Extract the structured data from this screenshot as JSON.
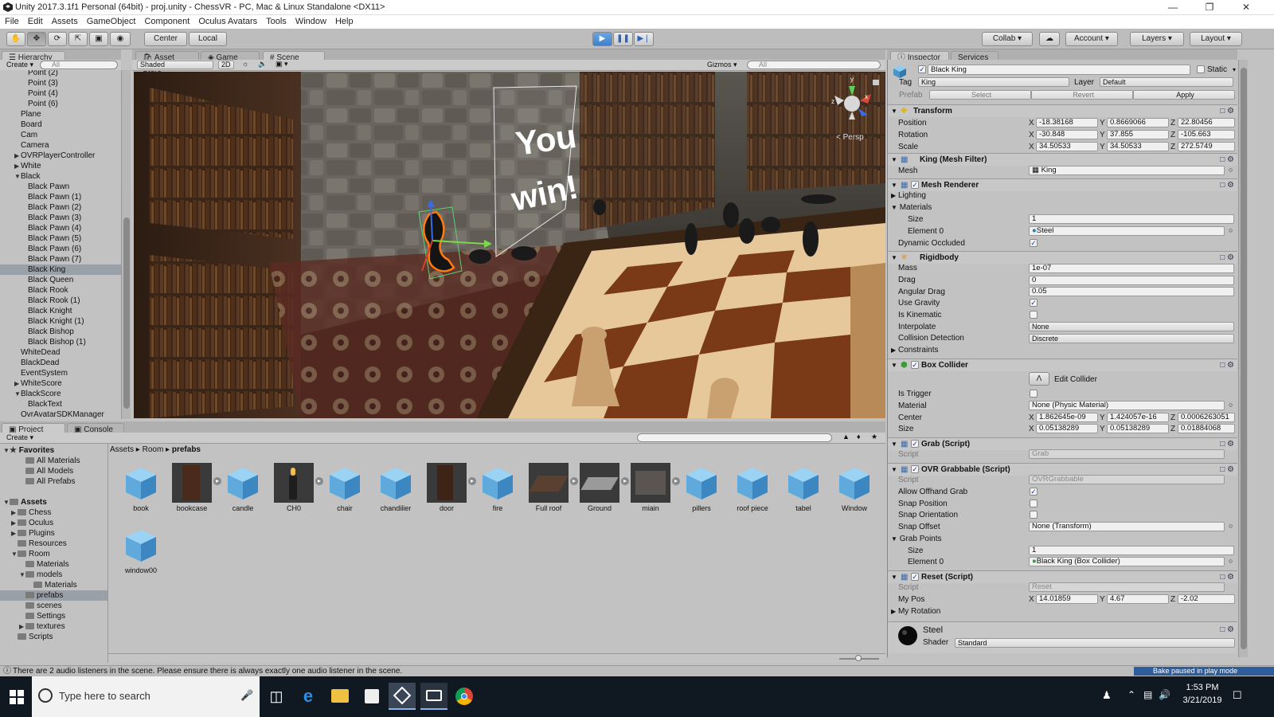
{
  "window": {
    "title": "Unity 2017.3.1f1 Personal (64bit) - proj.unity - ChessVR - PC, Mac & Linux Standalone <DX11>"
  },
  "menu": [
    "File",
    "Edit",
    "Assets",
    "GameObject",
    "Component",
    "Oculus Avatars",
    "Tools",
    "Window",
    "Help"
  ],
  "toolbar": {
    "center": "Center",
    "local": "Local",
    "collab": "Collab",
    "account": "Account",
    "layers": "Layers",
    "layout": "Layout"
  },
  "hierarchy": {
    "tab": "Hierarchy",
    "create": "Create",
    "search": "All",
    "rows": [
      {
        "label": "Point (2)",
        "indent": 3,
        "arrow": ""
      },
      {
        "label": "Point (3)",
        "indent": 3,
        "arrow": ""
      },
      {
        "label": "Point (4)",
        "indent": 3,
        "arrow": ""
      },
      {
        "label": "Point (6)",
        "indent": 3,
        "arrow": ""
      },
      {
        "label": "Plane",
        "indent": 2,
        "arrow": ""
      },
      {
        "label": "Board",
        "indent": 2,
        "arrow": ""
      },
      {
        "label": "Cam",
        "indent": 2,
        "arrow": ""
      },
      {
        "label": "Camera",
        "indent": 2,
        "arrow": ""
      },
      {
        "label": "OVRPlayerController",
        "indent": 2,
        "arrow": "▶"
      },
      {
        "label": "White",
        "indent": 2,
        "arrow": "▶"
      },
      {
        "label": "Black",
        "indent": 2,
        "arrow": "▼"
      },
      {
        "label": "Black Pawn",
        "indent": 3,
        "arrow": ""
      },
      {
        "label": "Black Pawn (1)",
        "indent": 3,
        "arrow": ""
      },
      {
        "label": "Black Pawn (2)",
        "indent": 3,
        "arrow": ""
      },
      {
        "label": "Black Pawn (3)",
        "indent": 3,
        "arrow": ""
      },
      {
        "label": "Black Pawn (4)",
        "indent": 3,
        "arrow": ""
      },
      {
        "label": "Black Pawn (5)",
        "indent": 3,
        "arrow": ""
      },
      {
        "label": "Black Pawn (6)",
        "indent": 3,
        "arrow": ""
      },
      {
        "label": "Black Pawn (7)",
        "indent": 3,
        "arrow": ""
      },
      {
        "label": "Black King",
        "indent": 3,
        "arrow": "",
        "selected": true
      },
      {
        "label": "Black Queen",
        "indent": 3,
        "arrow": ""
      },
      {
        "label": "Black Rook",
        "indent": 3,
        "arrow": ""
      },
      {
        "label": "Black Rook (1)",
        "indent": 3,
        "arrow": ""
      },
      {
        "label": "Black Knight",
        "indent": 3,
        "arrow": ""
      },
      {
        "label": "Black Knight (1)",
        "indent": 3,
        "arrow": ""
      },
      {
        "label": "Black Bishop",
        "indent": 3,
        "arrow": ""
      },
      {
        "label": "Black Bishop (1)",
        "indent": 3,
        "arrow": ""
      },
      {
        "label": "WhiteDead",
        "indent": 2,
        "arrow": ""
      },
      {
        "label": "BlackDead",
        "indent": 2,
        "arrow": ""
      },
      {
        "label": "EventSystem",
        "indent": 2,
        "arrow": ""
      },
      {
        "label": "WhiteScore",
        "indent": 2,
        "arrow": "▶"
      },
      {
        "label": "BlackScore",
        "indent": 2,
        "arrow": "▼"
      },
      {
        "label": "BlackText",
        "indent": 3,
        "arrow": ""
      },
      {
        "label": "OvrAvatarSDKManager",
        "indent": 2,
        "arrow": ""
      }
    ]
  },
  "sceneTabs": {
    "assetStore": "Asset Store",
    "game": "Game",
    "scene": "Scene"
  },
  "sceneBar": {
    "shaded": "Shaded",
    "twoD": "2D",
    "gizmos": "Gizmos",
    "search": "All"
  },
  "scene": {
    "win1": "You",
    "win2": "win!",
    "persp": "< Persp"
  },
  "inspector": {
    "tab": "Inspector",
    "services": "Services",
    "name": "Black King",
    "static": "Static",
    "tagLabel": "Tag",
    "tag": "King",
    "layerLabel": "Layer",
    "layer": "Default",
    "prefabLabel": "Prefab",
    "select": "Select",
    "revert": "Revert",
    "apply": "Apply",
    "transform": {
      "title": "Transform",
      "rows": [
        {
          "label": "Position",
          "x": "-18.38168",
          "y": "0.8669066",
          "z": "22.80456"
        },
        {
          "label": "Rotation",
          "x": "-30.848",
          "y": "37.855",
          "z": "-105.663"
        },
        {
          "label": "Scale",
          "x": "34.50533",
          "y": "34.50533",
          "z": "272.5749"
        }
      ]
    },
    "meshFilter": {
      "title": "King (Mesh Filter)",
      "meshLabel": "Mesh",
      "mesh": "King"
    },
    "meshRenderer": {
      "title": "Mesh Renderer",
      "lighting": "Lighting",
      "materials": "Materials",
      "sizeLabel": "Size",
      "size": "1",
      "element0Label": "Element 0",
      "element0": "Steel",
      "dynamicOccluded": "Dynamic Occluded"
    },
    "rigidbody": {
      "title": "Rigidbody",
      "massLabel": "Mass",
      "mass": "1e-07",
      "dragLabel": "Drag",
      "drag": "0",
      "angularDragLabel": "Angular Drag",
      "angularDrag": "0.05",
      "useGravity": "Use Gravity",
      "isKinematic": "Is Kinematic",
      "interpolateLabel": "Interpolate",
      "interpolate": "None",
      "collisionLabel": "Collision Detection",
      "collision": "Discrete",
      "constraints": "Constraints"
    },
    "boxCollider": {
      "title": "Box Collider",
      "editCollider": "Edit Collider",
      "isTrigger": "Is Trigger",
      "materialLabel": "Material",
      "material": "None (Physic Material)",
      "centerLabel": "Center",
      "cx": "1.862645e-09",
      "cy": "1.424057e-16",
      "cz": "0.0006263051",
      "sizeLabel": "Size",
      "sx": "0.05138289",
      "sy": "0.05138289",
      "sz": "0.01884068"
    },
    "grab": {
      "title": "Grab (Script)",
      "scriptLabel": "Script",
      "script": "Grab"
    },
    "ovrGrabbable": {
      "title": "OVR Grabbable (Script)",
      "scriptLabel": "Script",
      "script": "OVRGrabbable",
      "allowOffhand": "Allow Offhand Grab",
      "snapPosition": "Snap Position",
      "snapOrientation": "Snap Orientation",
      "snapOffsetLabel": "Snap Offset",
      "snapOffset": "None (Transform)",
      "grabPoints": "Grab Points",
      "sizeLabel": "Size",
      "size": "1",
      "element0Label": "Element 0",
      "element0": "Black King (Box Collider)"
    },
    "reset": {
      "title": "Reset (Script)",
      "scriptLabel": "Script",
      "script": "Reset",
      "myPosLabel": "My Pos",
      "px": "14.01859",
      "py": "4.67",
      "pz": "-2.02",
      "myRotation": "My Rotation"
    },
    "material": {
      "name": "Steel",
      "shaderLabel": "Shader",
      "shader": "Standard"
    }
  },
  "project": {
    "tab": "Project",
    "console": "Console",
    "create": "Create",
    "breadcrumb": [
      "Assets",
      "Room",
      "prefabs"
    ],
    "tree": [
      {
        "label": "Favorites",
        "indent": 0,
        "arrow": "▼",
        "bold": true
      },
      {
        "label": "All Materials",
        "indent": 2,
        "arrow": ""
      },
      {
        "label": "All Models",
        "indent": 2,
        "arrow": ""
      },
      {
        "label": "All Prefabs",
        "indent": 2,
        "arrow": ""
      },
      {
        "label": "",
        "indent": 0,
        "arrow": ""
      },
      {
        "label": "Assets",
        "indent": 0,
        "arrow": "▼",
        "bold": true
      },
      {
        "label": "Chess",
        "indent": 1,
        "arrow": "▶"
      },
      {
        "label": "Oculus",
        "indent": 1,
        "arrow": "▶"
      },
      {
        "label": "Plugins",
        "indent": 1,
        "arrow": "▶"
      },
      {
        "label": "Resources",
        "indent": 1,
        "arrow": ""
      },
      {
        "label": "Room",
        "indent": 1,
        "arrow": "▼"
      },
      {
        "label": "Materials",
        "indent": 2,
        "arrow": ""
      },
      {
        "label": "models",
        "indent": 2,
        "arrow": "▼"
      },
      {
        "label": "Materials",
        "indent": 3,
        "arrow": ""
      },
      {
        "label": "prefabs",
        "indent": 2,
        "arrow": "",
        "selected": true
      },
      {
        "label": "scenes",
        "indent": 2,
        "arrow": ""
      },
      {
        "label": "Settings",
        "indent": 2,
        "arrow": ""
      },
      {
        "label": "textures",
        "indent": 2,
        "arrow": "▶"
      },
      {
        "label": "Scripts",
        "indent": 1,
        "arrow": ""
      }
    ],
    "assets": [
      {
        "name": "book",
        "kind": "cube"
      },
      {
        "name": "bookcase",
        "kind": "bookcase"
      },
      {
        "name": "candle",
        "kind": "cube"
      },
      {
        "name": "CH0",
        "kind": "candle"
      },
      {
        "name": "chair",
        "kind": "cube"
      },
      {
        "name": "chandilier",
        "kind": "cube"
      },
      {
        "name": "door",
        "kind": "door"
      },
      {
        "name": "fire",
        "kind": "cube"
      },
      {
        "name": "Full roof",
        "kind": "roof"
      },
      {
        "name": "Ground",
        "kind": "ground"
      },
      {
        "name": "miain",
        "kind": "miain"
      },
      {
        "name": "pillers",
        "kind": "cube"
      },
      {
        "name": "roof piece",
        "kind": "cube"
      },
      {
        "name": "tabel",
        "kind": "cube"
      },
      {
        "name": "Window",
        "kind": "cube"
      },
      {
        "name": "window00",
        "kind": "cube"
      }
    ]
  },
  "status": {
    "message": "There are 2 audio listeners in the scene. Please ensure there is always exactly one audio listener in the scene.",
    "bake": "Bake paused",
    "bakeSuffix": "in play mode"
  },
  "taskbar": {
    "search": "Type here to search",
    "time": "1:53 PM",
    "date": "3/21/2019"
  }
}
